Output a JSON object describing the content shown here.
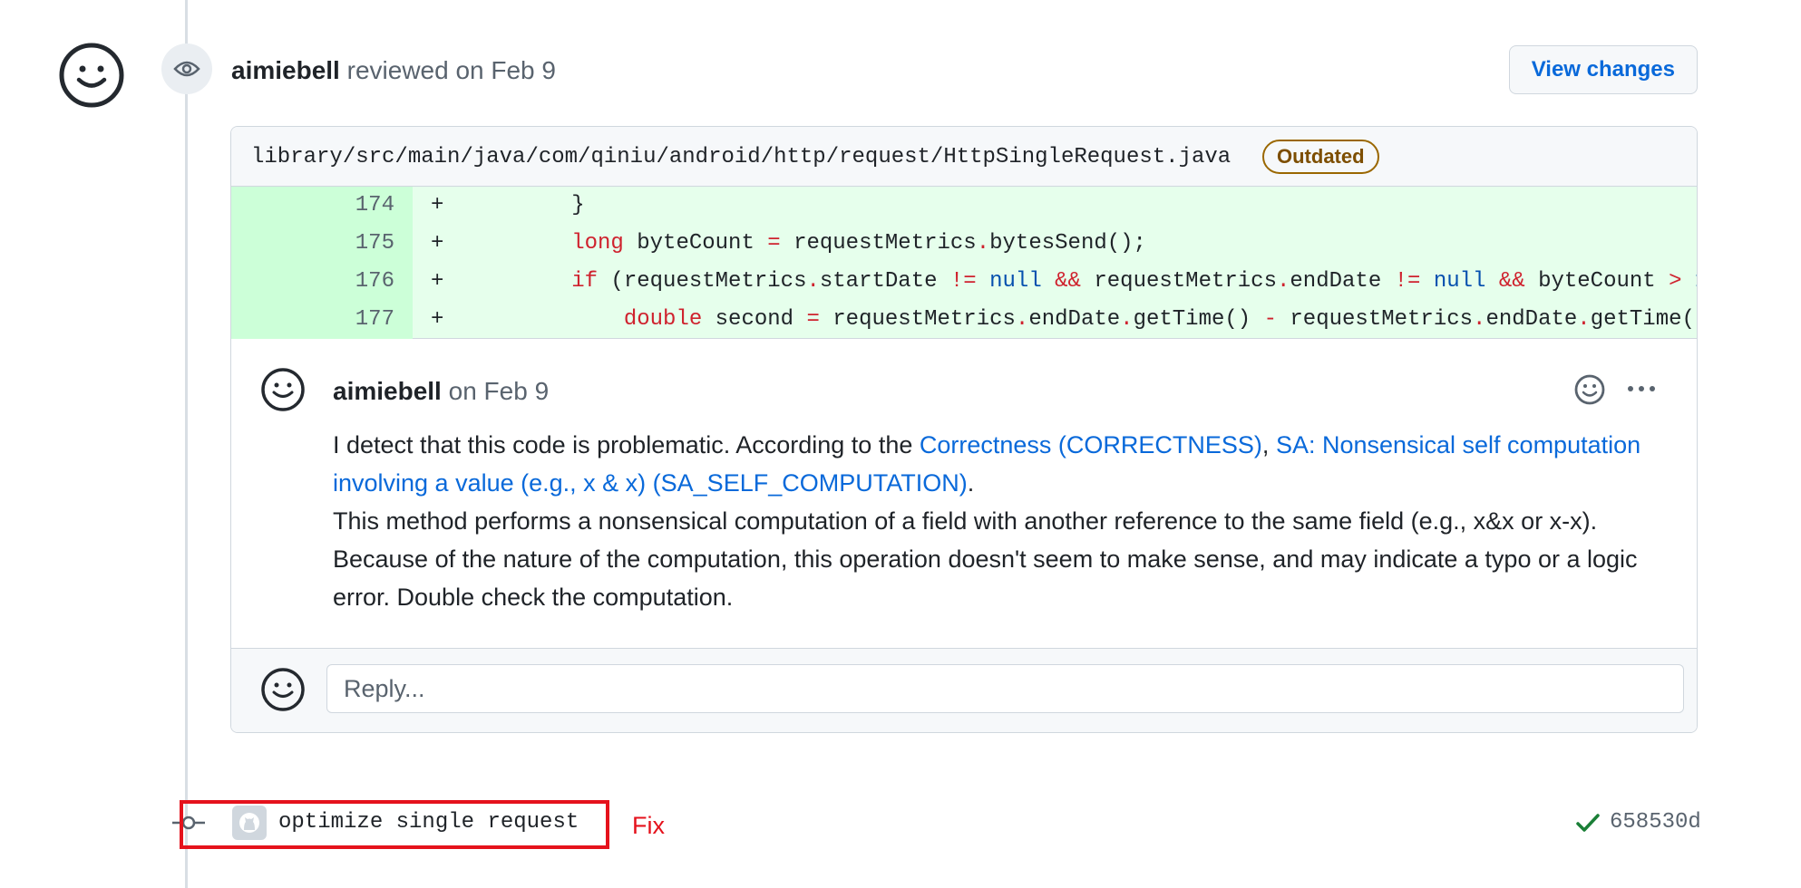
{
  "review": {
    "author": "aimiebell",
    "action": "reviewed on Feb 9",
    "view_changes_label": "View changes"
  },
  "file": {
    "path": "library/src/main/java/com/qiniu/android/http/request/HttpSingleRequest.java",
    "badge": "Outdated"
  },
  "diff": {
    "lines": [
      {
        "num": "174",
        "sign": "+"
      },
      {
        "num": "175",
        "sign": "+"
      },
      {
        "num": "176",
        "sign": "+"
      },
      {
        "num": "177",
        "sign": "+"
      }
    ]
  },
  "comment": {
    "author": "aimiebell",
    "date": "on Feb 9",
    "text_intro": "I detect that this code is problematic. According to the ",
    "link1": "Correctness (CORRECTNESS)",
    "separator": ", ",
    "link2": "SA: Nonsensical self computation involving a value (e.g., x & x) (SA_SELF_COMPUTATION)",
    "period": ".",
    "text_body": "This method performs a nonsensical computation of a field with another reference to the same field (e.g., x&x or x-x). Because of the nature of the computation, this operation doesn't seem to make sense, and may indicate a typo or a logic error. Double check the computation."
  },
  "reply": {
    "placeholder": "Reply..."
  },
  "commit": {
    "message": "optimize single request",
    "annotation": "Fix",
    "sha": "658530d"
  },
  "colors": {
    "link": "#0969da",
    "added_bg": "#e6ffec",
    "added_num_bg": "#ccffd8",
    "highlight": "#e5121c",
    "badge": "#9a6700",
    "success": "#1a7f37"
  }
}
